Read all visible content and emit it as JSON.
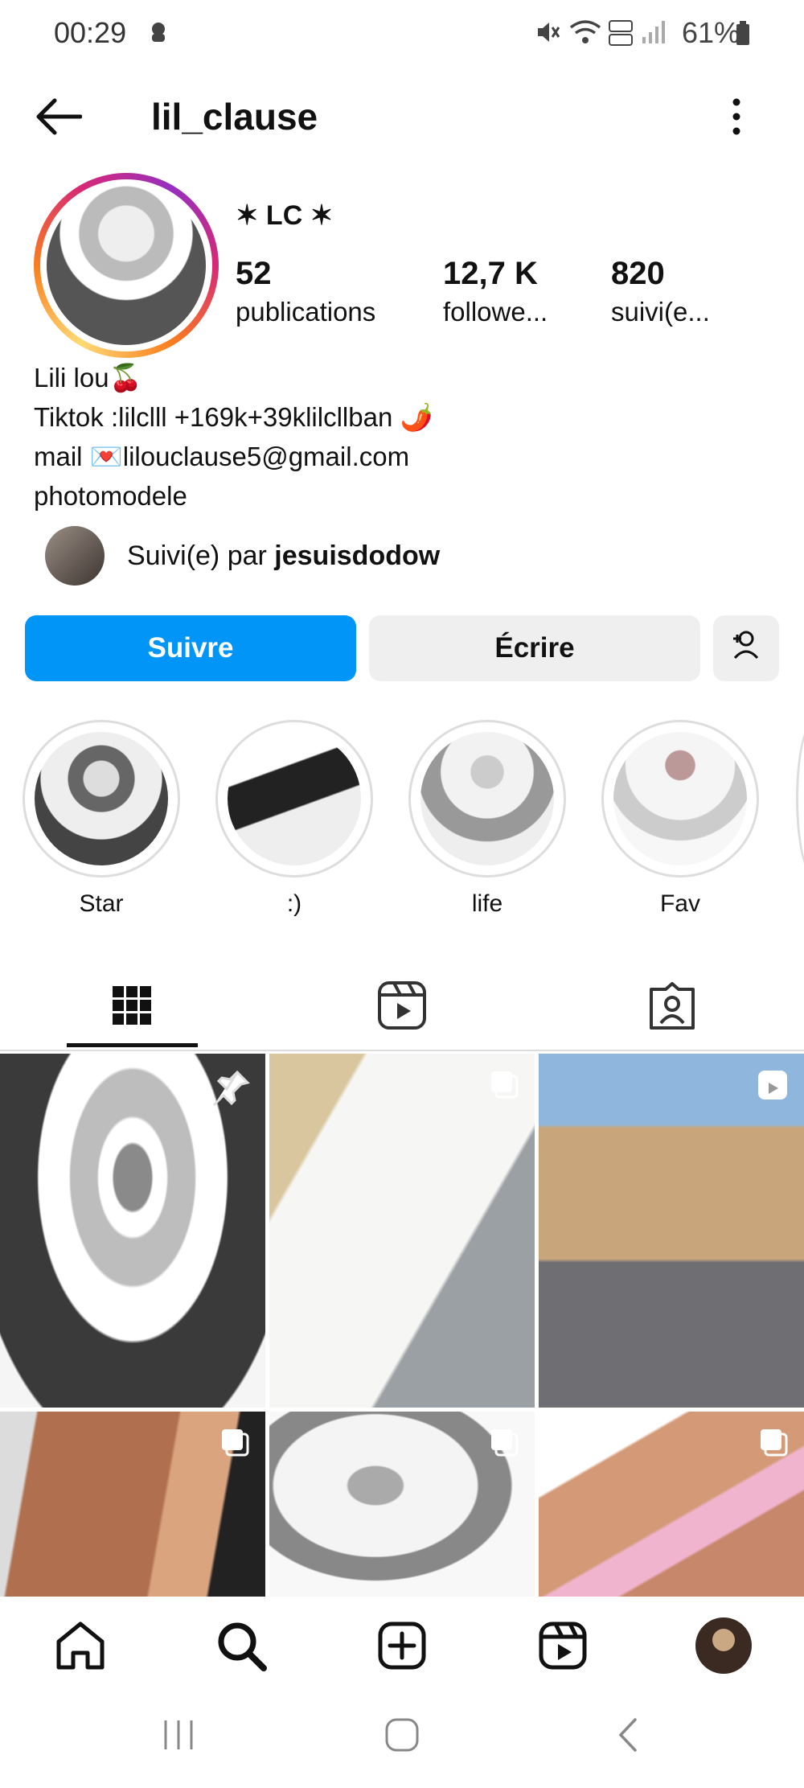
{
  "status_bar": {
    "time": "00:29",
    "battery": "61%"
  },
  "header": {
    "username": "lil_clause"
  },
  "profile": {
    "display_name": "✶ LC ✶",
    "stats": [
      {
        "value": "52",
        "label": "publications"
      },
      {
        "value": "12,7 K",
        "label": "followe..."
      },
      {
        "value": "820",
        "label": "suivi(e..."
      }
    ],
    "bio": [
      "Lili lou🍒",
      "Tiktok :lilclll +169k+39klilcllban 🌶️",
      "mail 💌lilouclause5@gmail.com",
      "photomodele"
    ],
    "followed_by_prefix": "Suivi(e) par ",
    "followed_by_user": "jesuisdodow"
  },
  "actions": {
    "follow": "Suivre",
    "message": "Écrire"
  },
  "highlights": [
    {
      "label": "Star"
    },
    {
      "label": ":)"
    },
    {
      "label": "life"
    },
    {
      "label": "Fav"
    }
  ],
  "tabs": [
    "grid-icon",
    "reels-icon",
    "tagged-icon"
  ],
  "colors": {
    "accent": "#0095f6",
    "ring_start": "#feda75",
    "ring_end": "#962fbf"
  }
}
